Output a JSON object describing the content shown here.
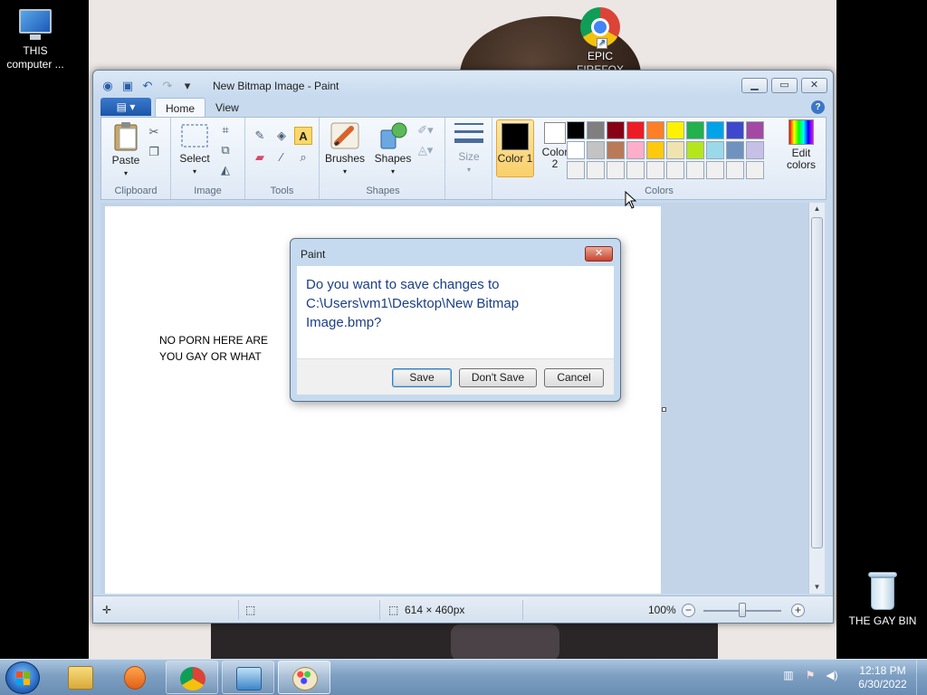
{
  "desktop": {
    "icons": [
      {
        "label": "THIS computer ..."
      },
      {
        "label": "EPIC FIREFOX"
      },
      {
        "label": "THE GAY BIN"
      }
    ]
  },
  "window": {
    "title": "New Bitmap Image - Paint"
  },
  "ribbon": {
    "file_menu_icon": "menu-icon",
    "tabs": [
      "Home",
      "View"
    ],
    "groups": {
      "clipboard": {
        "label": "Clipboard",
        "paste": "Paste"
      },
      "image": {
        "label": "Image",
        "select": "Select"
      },
      "tools": {
        "label": "Tools"
      },
      "shapes": {
        "label": "Shapes",
        "brushes": "Brushes",
        "shapes_btn": "Shapes"
      },
      "size": {
        "label": "Size"
      },
      "colors": {
        "label": "Colors",
        "color1": "Color 1",
        "color2": "Color 2",
        "edit": "Edit colors"
      }
    },
    "palette": [
      "#000000",
      "#7f7f7f",
      "#880015",
      "#ed1c24",
      "#ff7f27",
      "#fff200",
      "#22b14c",
      "#00a2e8",
      "#3f48cc",
      "#a349a4",
      "#ffffff",
      "#c3c3c3",
      "#b97a57",
      "#ffaec9",
      "#ffc90e",
      "#efe4b0",
      "#b5e61d",
      "#99d9ea",
      "#7092be",
      "#c8bfe7",
      "#f0f0f0",
      "#f0f0f0",
      "#f0f0f0",
      "#f0f0f0",
      "#f0f0f0",
      "#f0f0f0",
      "#f0f0f0",
      "#f0f0f0",
      "#f0f0f0",
      "#f0f0f0"
    ],
    "color1_value": "#000000",
    "color2_value": "#ffffff"
  },
  "canvas": {
    "text": "NO PORN HERE ARE\nYOU GAY OR WHAT"
  },
  "statusbar": {
    "dimensions": "614 × 460px",
    "zoom": "100%"
  },
  "dialog": {
    "title": "Paint",
    "message": "Do you want to save changes to C:\\Users\\vm1\\Desktop\\New Bitmap Image.bmp?",
    "save": "Save",
    "dont_save": "Don't Save",
    "cancel": "Cancel"
  },
  "taskbar": {
    "time": "12:18 PM",
    "date": "6/30/2022"
  }
}
